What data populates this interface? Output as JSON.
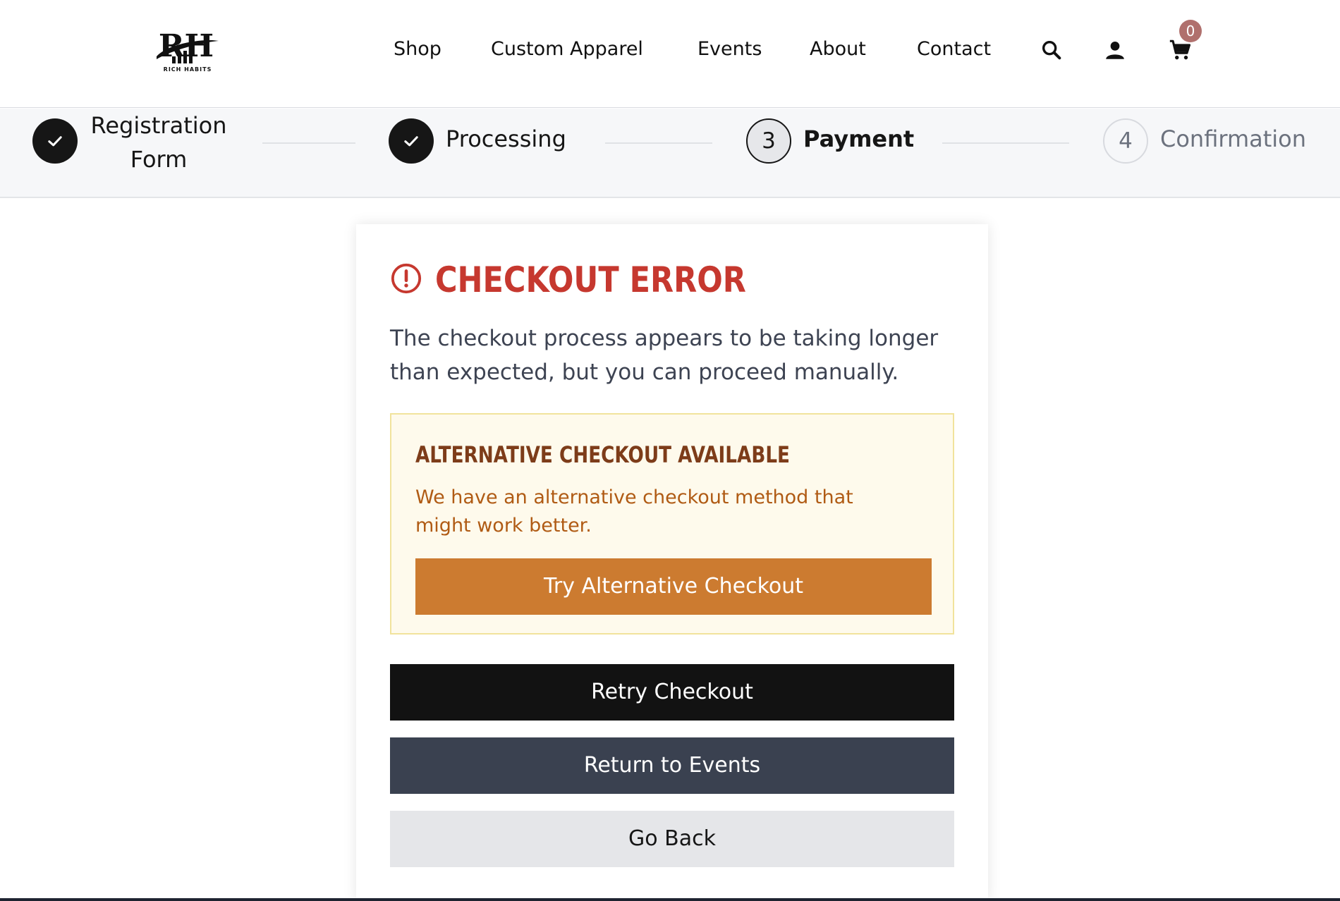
{
  "brand": {
    "logo_name": "Rich Habits",
    "logo_monogram": "RH",
    "logo_subtext": "RICH HABITS"
  },
  "nav": {
    "items": [
      "Shop",
      "Custom Apparel",
      "Events",
      "About",
      "Contact"
    ],
    "icons": [
      "search-icon",
      "user-icon",
      "cart-icon"
    ],
    "cart_count": "0",
    "cart_badge_color": "#b0706d"
  },
  "stepper": {
    "steps": [
      {
        "line1": "Registration",
        "line2": "Form",
        "state": "done"
      },
      {
        "label": "Processing",
        "state": "done"
      },
      {
        "number": "3",
        "label": "Payment",
        "state": "current"
      },
      {
        "number": "4",
        "label": "Confirmation",
        "state": "upcoming"
      }
    ]
  },
  "error": {
    "icon": "alert-circle-icon",
    "title": "CHECKOUT ERROR",
    "title_color": "#c6382f",
    "description": "The checkout process appears to be taking longer than expected, but you can proceed manually."
  },
  "alternative": {
    "title": "ALTERNATIVE CHECKOUT AVAILABLE",
    "description": "We have an alternative checkout method that might work better.",
    "button_label": "Try Alternative Checkout",
    "button_color": "#cc7b30"
  },
  "actions": {
    "retry_label": "Retry Checkout",
    "return_label": "Return to Events",
    "back_label": "Go Back"
  }
}
